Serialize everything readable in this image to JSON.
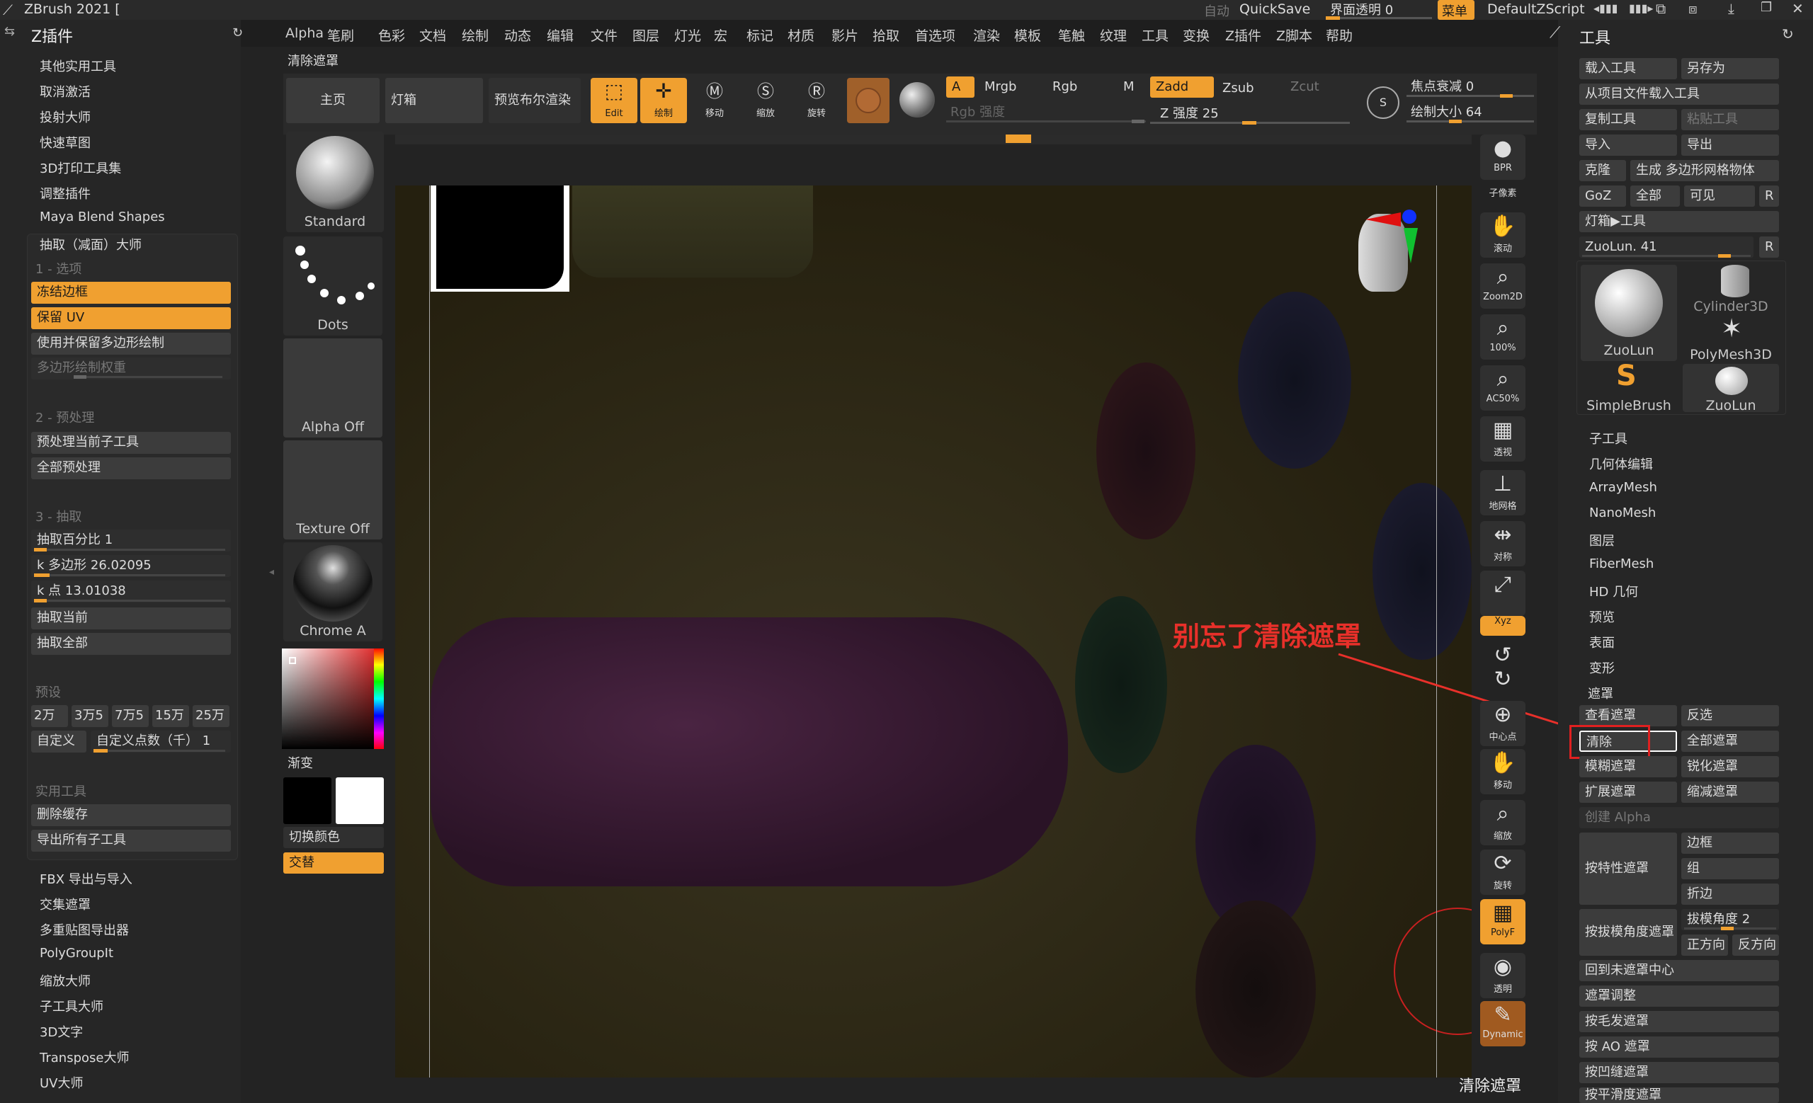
{
  "app": {
    "title": "ZBrush 2021 [",
    "auto_label": "自动",
    "quicksave": "QuickSave",
    "ui_transparency": "界面透明 0",
    "menu_button": "菜单",
    "script": "DefaultZScript"
  },
  "menubar": [
    "Alpha",
    "笔刷",
    "色彩",
    "文档",
    "绘制",
    "动态",
    "编辑",
    "文件",
    "图层",
    "灯光",
    "宏",
    "标记",
    "材质",
    "影片",
    "拾取",
    "首选项",
    "渲染",
    "模板",
    "笔触",
    "纹理",
    "工具",
    "变换",
    "Z插件",
    "Z脚本",
    "帮助"
  ],
  "left_panel": {
    "title": "Z插件",
    "top_items": [
      "其他实用工具",
      "取消激活",
      "投射大师",
      "快速草图",
      "3D打印工具集",
      "调整插件",
      "Maya Blend Shapes"
    ],
    "decimation": {
      "header": "抽取（减面）大师",
      "section1": "1 - 选项",
      "freeze_borders": "冻结边框",
      "keep_uv": "保留 UV",
      "use_polypaint": "使用并保留多边形绘制",
      "polypaint_weight": "多边形绘制权重",
      "section2": "2 - 预处理",
      "preprocess_current": "预处理当前子工具",
      "preprocess_all": "全部预处理",
      "section3": "3 - 抽取",
      "percent": "抽取百分比 1",
      "kpolys": "k 多边形 26.02095",
      "kpoints": "k 点 13.01038",
      "decimate_current": "抽取当前",
      "decimate_all": "抽取全部",
      "presets_label": "预设",
      "presets": [
        "2万",
        "3万5",
        "7万5",
        "15万",
        "25万"
      ],
      "custom": "自定义",
      "custom_points": "自定义点数（千） 1",
      "utilities_label": "实用工具",
      "delete_cache": "删除缓存",
      "export_all": "导出所有子工具"
    },
    "bottom_items": [
      "FBX 导出与导入",
      "交集遮罩",
      "多重贴图导出器",
      "PolyGroupIt",
      "缩放大师",
      "子工具大师",
      "3D文字",
      "Transpose大师",
      "UV大师"
    ]
  },
  "tooltip_title": "清除遮罩",
  "top_shelf": {
    "home": "主页",
    "lightbox": "灯箱",
    "bpr": "预览布尔渲染",
    "edit": "Edit",
    "draw": "绘制",
    "move": "移动",
    "scale": "缩放",
    "rotate": "旋转",
    "a": "A",
    "mrgb": "Mrgb",
    "rgb": "Rgb",
    "m": "M",
    "zadd": "Zadd",
    "zsub": "Zsub",
    "zcut": "Zcut",
    "rgb_intensity": "Rgb 强度",
    "z_intensity": "Z 强度 25",
    "focal_shift": "焦点衰减 0",
    "draw_size": "绘制大小 64"
  },
  "brush_column": {
    "standard": "Standard",
    "dots": "Dots",
    "alpha_off": "Alpha Off",
    "texture_off": "Texture Off",
    "chrome": "Chrome A",
    "gradient": "渐变",
    "switch_color": "切换颜色",
    "alternate": "交替"
  },
  "right_rail": [
    "BPR",
    "子像素",
    "滚动",
    "Zoom2D",
    "100%",
    "AC50%",
    "透视",
    "地网格",
    "对称",
    "",
    "Xyz",
    "",
    "",
    "中心点",
    "移动",
    "缩放",
    "旋转",
    "PolyF",
    "透明",
    "Dynamic"
  ],
  "annotation": {
    "text": "别忘了清除遮罩",
    "color": "#e8302a"
  },
  "status_bottom": "清除遮罩",
  "tool_panel": {
    "title": "工具",
    "load_tool": "载入工具",
    "save_as": "另存为",
    "load_from_project": "从项目文件载入工具",
    "copy_tool": "复制工具",
    "paste_tool": "粘贴工具",
    "import": "导入",
    "export": "导出",
    "clone": "克隆",
    "make_polymesh": "生成 多边形网格物体",
    "goz": "GoZ",
    "all": "全部",
    "visible": "可见",
    "r": "R",
    "lightbox_tools": "灯箱▶工具",
    "current_tool": "ZuoLun. 41",
    "tools": [
      "ZuoLun",
      "Cylinder3D",
      "PolyMesh3D",
      "SimpleBrush",
      "ZuoLun"
    ],
    "subpalettes": [
      "子工具",
      "几何体编辑",
      "ArrayMesh",
      "NanoMesh",
      "图层",
      "FiberMesh",
      "HD 几何",
      "预览",
      "表面",
      "变形"
    ],
    "masking": {
      "header": "遮罩",
      "view_mask": "查看遮罩",
      "inverse": "反选",
      "clear": "清除",
      "mask_all": "全部遮罩",
      "blur": "模糊遮罩",
      "sharpen": "锐化遮罩",
      "grow": "扩展遮罩",
      "shrink": "缩减遮罩",
      "create_alpha": "创建 Alpha",
      "mask_by_feature": "按特性遮罩",
      "border": "边框",
      "groups": "组",
      "crease": "折边",
      "mask_by_angle": "按拔模角度遮罩",
      "draft_angle": "拔模角度 2",
      "positive": "正方向",
      "negative": "反方向",
      "unmasked_center": "回到未遮罩中心",
      "mask_adjust": "遮罩调整",
      "mask_by_fibers": "按毛发遮罩",
      "mask_by_ao": "按 AO 遮罩",
      "mask_by_cavity": "按凹缝遮罩",
      "mask_by_smoothness": "按平滑度遮罩"
    }
  }
}
